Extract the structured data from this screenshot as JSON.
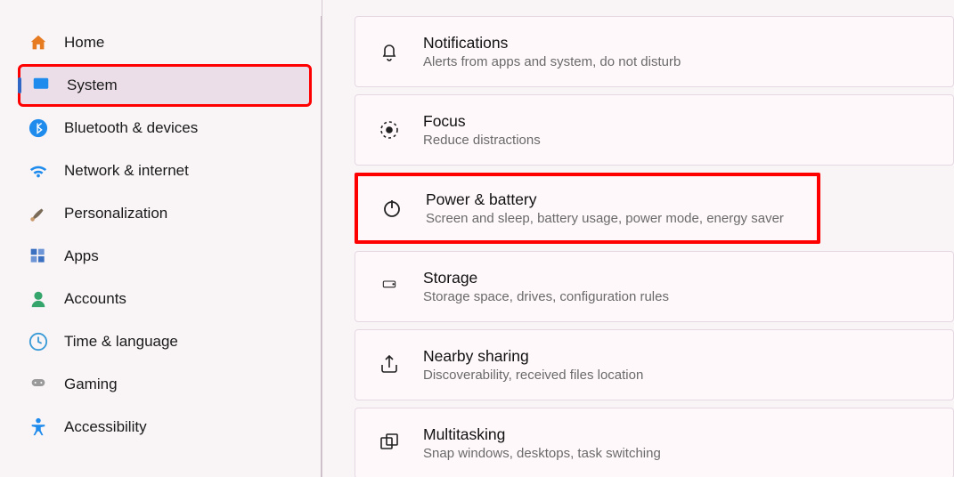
{
  "sidebar": {
    "items": [
      {
        "label": "Home"
      },
      {
        "label": "System"
      },
      {
        "label": "Bluetooth & devices"
      },
      {
        "label": "Network & internet"
      },
      {
        "label": "Personalization"
      },
      {
        "label": "Apps"
      },
      {
        "label": "Accounts"
      },
      {
        "label": "Time & language"
      },
      {
        "label": "Gaming"
      },
      {
        "label": "Accessibility"
      }
    ]
  },
  "main": {
    "cards": [
      {
        "title": "Notifications",
        "sub": "Alerts from apps and system, do not disturb"
      },
      {
        "title": "Focus",
        "sub": "Reduce distractions"
      },
      {
        "title": "Power & battery",
        "sub": "Screen and sleep, battery usage, power mode, energy saver"
      },
      {
        "title": "Storage",
        "sub": "Storage space, drives, configuration rules"
      },
      {
        "title": "Nearby sharing",
        "sub": "Discoverability, received files location"
      },
      {
        "title": "Multitasking",
        "sub": "Snap windows, desktops, task switching"
      }
    ]
  }
}
